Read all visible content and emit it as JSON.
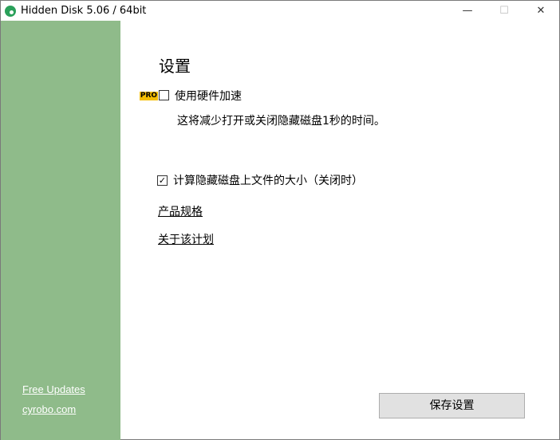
{
  "window": {
    "title": "Hidden Disk 5.06 / 64bit",
    "minimize": "—",
    "maximize": "☐",
    "close": "✕"
  },
  "sidebar": {
    "free_updates": "Free Updates",
    "site": "cyrobo.com",
    "color": "#8fbb8a"
  },
  "main": {
    "heading": "设置",
    "pro_badge": "PRO",
    "hw_accel": {
      "label": "使用硬件加速",
      "checked": false,
      "description": "这将减少打开或关闭隐藏磁盘1秒的时间。"
    },
    "calc_size": {
      "label": "计算隐藏磁盘上文件的大小（关闭时）",
      "checked": true,
      "mark": "✓"
    },
    "links": [
      "产品规格",
      "关于该计划"
    ],
    "save_button": "保存设置"
  }
}
